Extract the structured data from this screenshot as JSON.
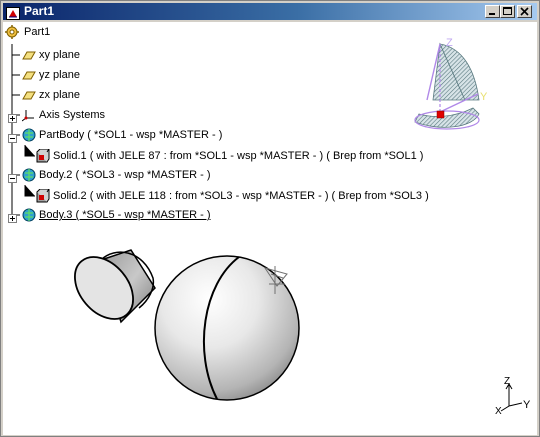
{
  "window": {
    "title": "Part1",
    "controls": [
      "minimize",
      "maximize",
      "close"
    ]
  },
  "tree": {
    "root": "Part1",
    "items": [
      {
        "label": "xy plane",
        "icon": "plane-icon"
      },
      {
        "label": "yz plane",
        "icon": "plane-icon"
      },
      {
        "label": "zx plane",
        "icon": "plane-icon"
      },
      {
        "label": "Axis Systems",
        "icon": "axis-system-icon"
      },
      {
        "label": "PartBody ( *SOL1 - wsp *MASTER -  )",
        "icon": "body-icon"
      },
      {
        "label": "Solid.1 (  with JELE 87 : from *SOL1 - wsp *MASTER -  ) ( Brep from *SOL1 )",
        "icon": "solid-icon"
      },
      {
        "label": "Body.2 ( *SOL3 - wsp *MASTER -  )",
        "icon": "body-icon"
      },
      {
        "label": "Solid.2 (  with JELE 118 : from *SOL3 - wsp *MASTER -  ) ( Brep from *SOL3 )",
        "icon": "solid-icon"
      },
      {
        "label": "Body.3 ( *SOL5 - wsp *MASTER -  )",
        "icon": "body-icon"
      }
    ]
  },
  "compass": {
    "x": "X",
    "y": "Y",
    "z": "Z"
  },
  "axis_triad": {
    "x": "X",
    "y": "Y",
    "z": "Z"
  }
}
